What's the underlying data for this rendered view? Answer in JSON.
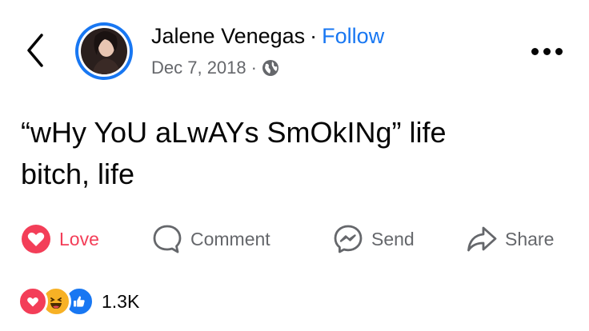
{
  "post": {
    "author": "Jalene Venegas",
    "separator": "·",
    "follow_label": "Follow",
    "date": "Dec 7, 2018",
    "meta_separator": "·",
    "privacy_icon": "globe-icon",
    "text_line1": "“wHy YoU aLwAYs SmOkINg” life",
    "text_line2": "bitch, life"
  },
  "actions": {
    "love_label": "Love",
    "comment_label": "Comment",
    "send_label": "Send",
    "share_label": "Share"
  },
  "reactions": {
    "icons": [
      "love-icon",
      "haha-icon",
      "like-icon"
    ],
    "count": "1.3K"
  },
  "colors": {
    "accent": "#1877f2",
    "love": "#f33e58",
    "secondary_text": "#65676b",
    "primary_text": "#050505"
  }
}
